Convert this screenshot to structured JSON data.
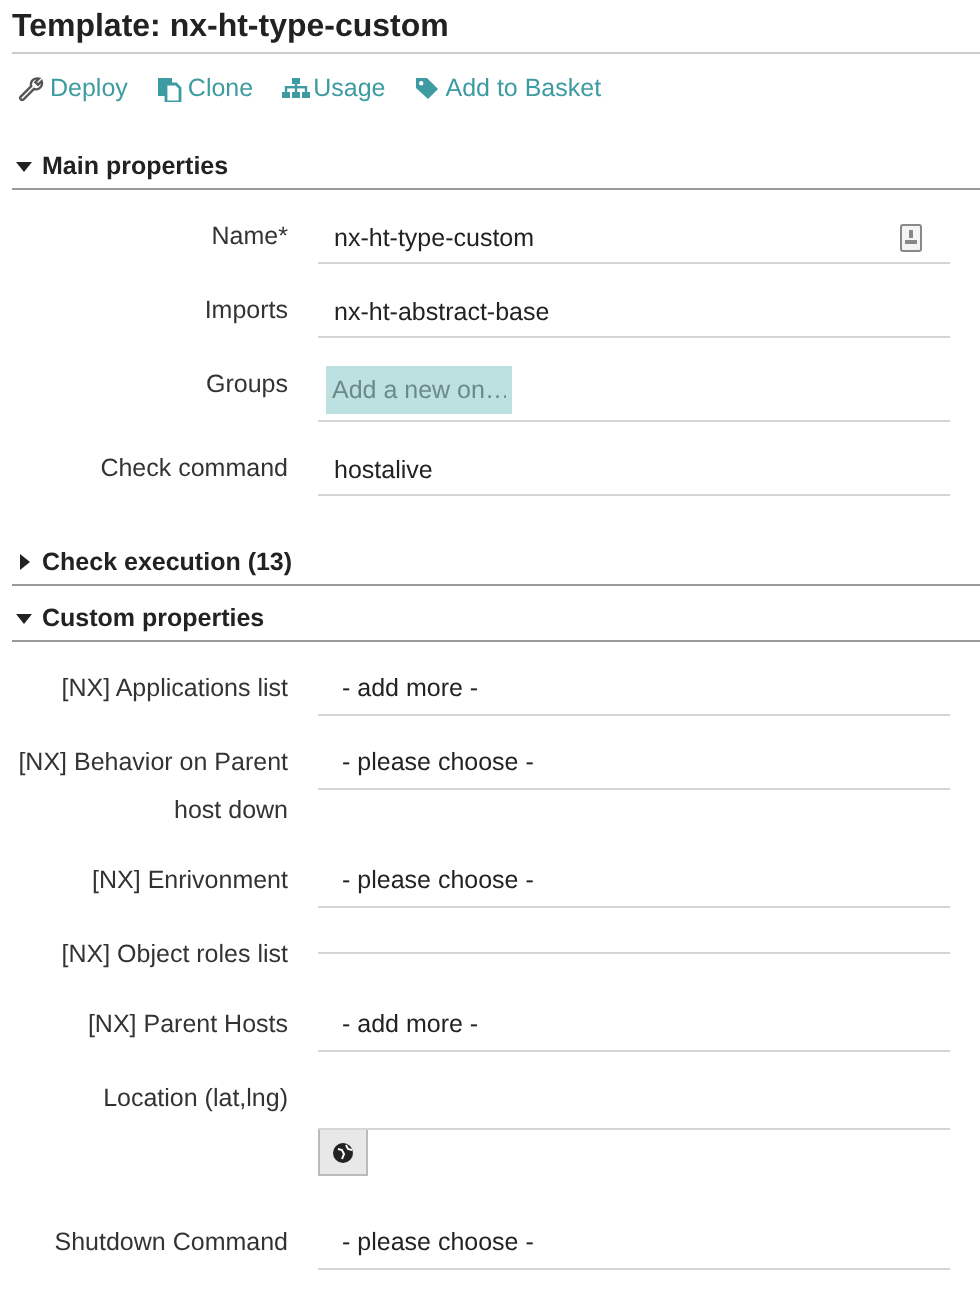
{
  "title": "Template: nx-ht-type-custom",
  "actions": [
    {
      "kind": "deploy",
      "label": "Deploy"
    },
    {
      "kind": "clone",
      "label": "Clone"
    },
    {
      "kind": "usage",
      "label": "Usage"
    },
    {
      "kind": "basket",
      "label": "Add to Basket"
    }
  ],
  "sections": [
    {
      "title": "Main properties",
      "expanded": true,
      "fields": [
        {
          "label": "Name*",
          "kind": "text",
          "value": "nx-ht-type-custom",
          "inherited_icon": true
        },
        {
          "label": "Imports",
          "kind": "text",
          "value": "nx-ht-abstract-base"
        },
        {
          "label": "Groups",
          "kind": "tags",
          "placeholder": "Add a new on…"
        },
        {
          "label": "Check command",
          "kind": "text",
          "value": "hostalive"
        }
      ]
    },
    {
      "title": "Check execution (13)",
      "expanded": false
    },
    {
      "title": "Custom properties",
      "expanded": true,
      "fields": [
        {
          "label": "[NX] Applications list",
          "kind": "select",
          "value": "- add more -"
        },
        {
          "label": "[NX] Behavior on Parent host down",
          "kind": "select",
          "value": "- please choose -"
        },
        {
          "label": "[NX] Enrivonment",
          "kind": "select",
          "value": "- please choose -"
        },
        {
          "label": "[NX] Object roles list",
          "kind": "empty"
        },
        {
          "label": "[NX] Parent Hosts",
          "kind": "select",
          "value": "- add more -"
        },
        {
          "label": "Location (lat,lng)",
          "kind": "location"
        },
        {
          "label": "Shutdown Command",
          "kind": "select",
          "value": "- please choose -"
        }
      ]
    }
  ]
}
